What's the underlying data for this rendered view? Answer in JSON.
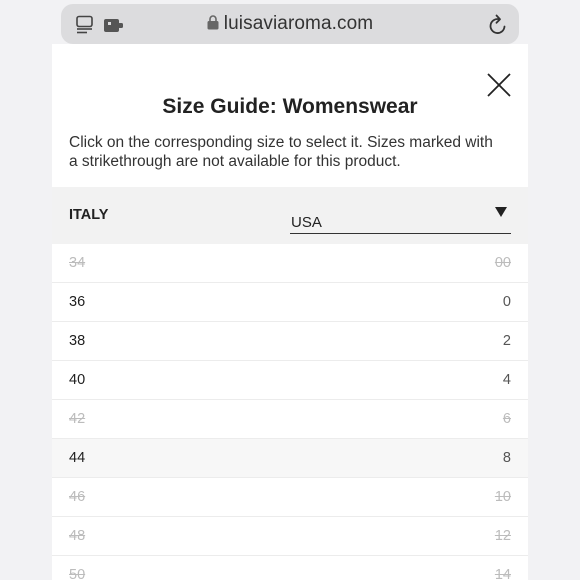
{
  "browser": {
    "domain": "luisaviaroma.com"
  },
  "modal": {
    "title": "Size Guide: Womenswear",
    "description": "Click on the corresponding size to select it. Sizes marked with a strikethrough are not available for this product.",
    "column_left": "ITALY",
    "column_right_selected": "USA"
  },
  "sizes": [
    {
      "italy": "34",
      "usa": "00",
      "available": false
    },
    {
      "italy": "36",
      "usa": "0",
      "available": true
    },
    {
      "italy": "38",
      "usa": "2",
      "available": true
    },
    {
      "italy": "40",
      "usa": "4",
      "available": true
    },
    {
      "italy": "42",
      "usa": "6",
      "available": false
    },
    {
      "italy": "44",
      "usa": "8",
      "available": true
    },
    {
      "italy": "46",
      "usa": "10",
      "available": false
    },
    {
      "italy": "48",
      "usa": "12",
      "available": false
    },
    {
      "italy": "50",
      "usa": "14",
      "available": false
    }
  ]
}
